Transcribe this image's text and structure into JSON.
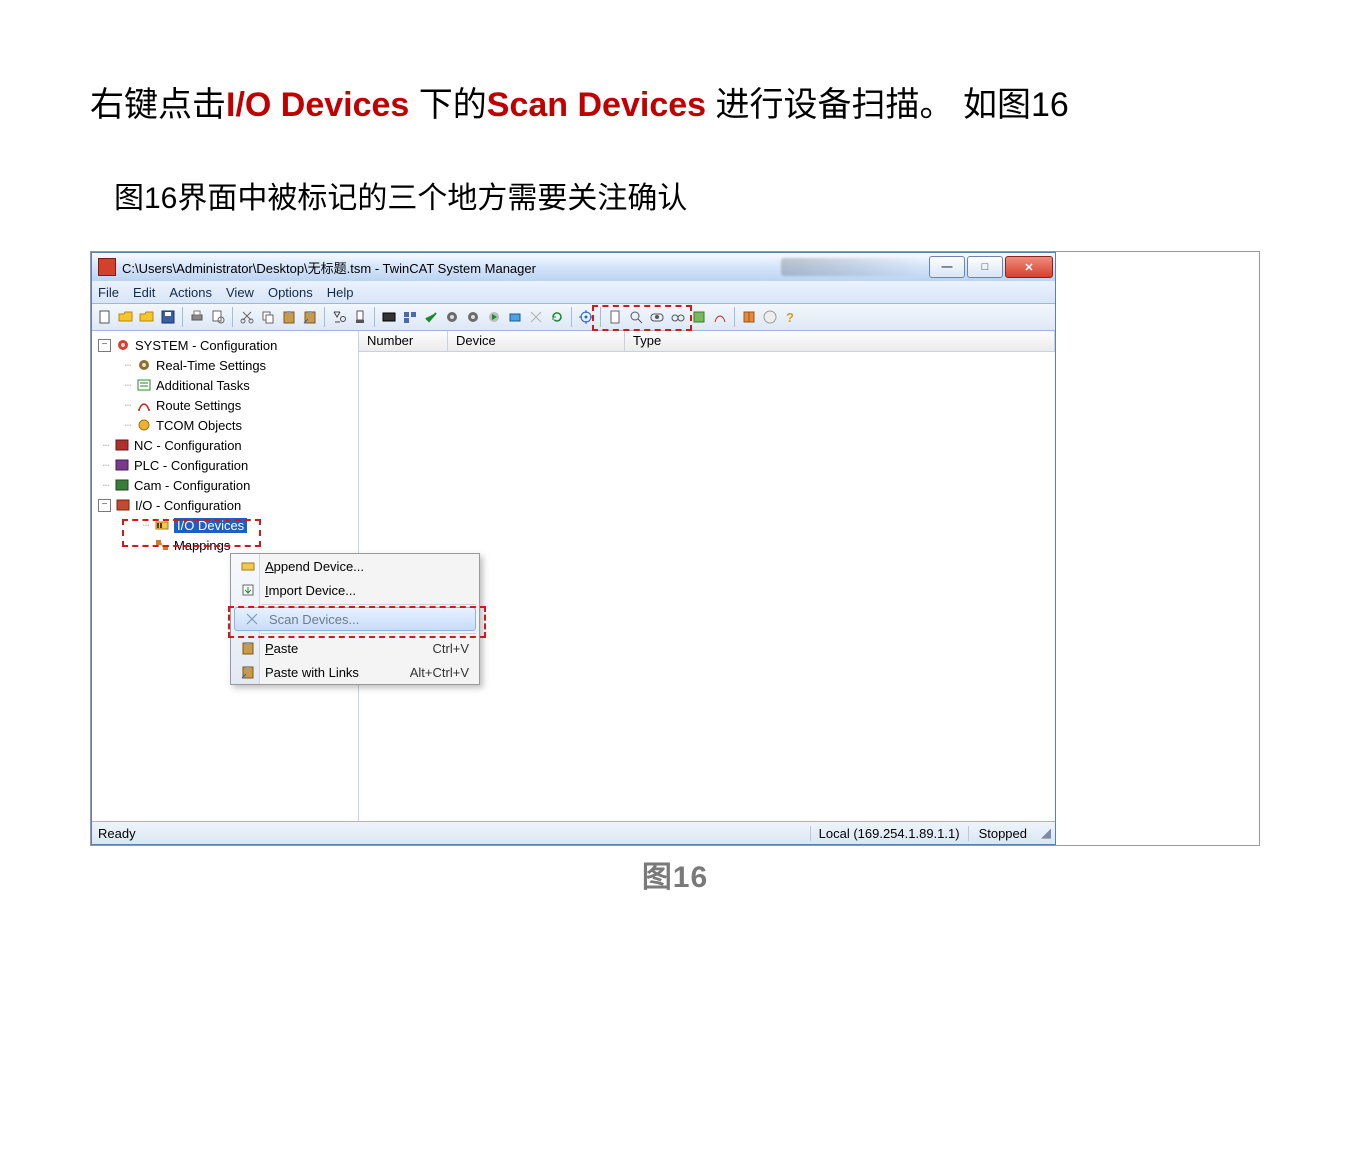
{
  "instruction": {
    "pre": "右键点击",
    "strong1": "I/O Devices",
    "mid": " 下的",
    "strong2": "Scan Devices",
    "post": " 进行设备扫描。  如图16"
  },
  "note": "图16界面中被标记的三个地方需要关注确认",
  "caption": "图16",
  "window": {
    "title": "C:\\Users\\Administrator\\Desktop\\无标题.tsm - TwinCAT System Manager",
    "menus": [
      "File",
      "Edit",
      "Actions",
      "View",
      "Options",
      "Help"
    ],
    "win_buttons": {
      "min": "—",
      "max": "□",
      "close": "✕"
    },
    "list_headers": {
      "number": "Number",
      "device": "Device",
      "type": "Type"
    },
    "tree": {
      "system": "SYSTEM - Configuration",
      "realtime": "Real-Time Settings",
      "addtasks": "Additional Tasks",
      "route": "Route Settings",
      "tcom": "TCOM Objects",
      "nc": "NC - Configuration",
      "plc": "PLC - Configuration",
      "cam": "Cam - Configuration",
      "io": "I/O - Configuration",
      "iodev": "I/O Devices",
      "mappings": "Mappings"
    },
    "context_menu": {
      "append": "Append Device...",
      "import": "Import Device...",
      "scan": "Scan Devices...",
      "paste": "Paste",
      "paste_acc": "Ctrl+V",
      "paste_links": "Paste with Links",
      "paste_links_acc": "Alt+Ctrl+V"
    },
    "status": {
      "ready": "Ready",
      "addr": "Local (169.254.1.89.1.1)",
      "state": "Stopped"
    }
  }
}
